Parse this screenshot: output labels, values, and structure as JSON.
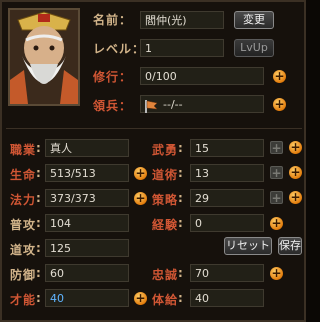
{
  "profile": {
    "name_label": "名前：",
    "name_value": "閻仲(光)",
    "rename_button": "変更",
    "level_label": "レベル：",
    "level_value": "1",
    "levelup_button": "LvUp",
    "training_label": "修行：",
    "training_value": "0/100",
    "troops_label": "領兵：",
    "troops_value": "--/--"
  },
  "stats_left": [
    {
      "label": "職業",
      "value": "真人"
    },
    {
      "label": "生命",
      "value": "513/513"
    },
    {
      "label": "法力",
      "value": "373/373"
    },
    {
      "label": "普攻",
      "value": "104"
    },
    {
      "label": "道攻",
      "value": "125"
    },
    {
      "label": "防御",
      "value": "60"
    },
    {
      "label": "才能",
      "value": "40"
    }
  ],
  "stats_right": [
    {
      "label": "武勇",
      "value": "15"
    },
    {
      "label": "道術",
      "value": "13"
    },
    {
      "label": "策略",
      "value": "29"
    },
    {
      "label": "経験",
      "value": "0"
    },
    {
      "label": "忠誠",
      "value": "70"
    },
    {
      "label": "体給",
      "value": "40"
    }
  ],
  "actions": {
    "reset_button": "リセット",
    "save_button": "保存"
  },
  "colors": {
    "label": "#d2b48a",
    "label_red": "#d05634",
    "talent_value": "#5fb4ff",
    "plus_orange": "#f2a020"
  },
  "icons": {
    "troops_icon": "flag-icon",
    "plus": "plus-icon"
  }
}
